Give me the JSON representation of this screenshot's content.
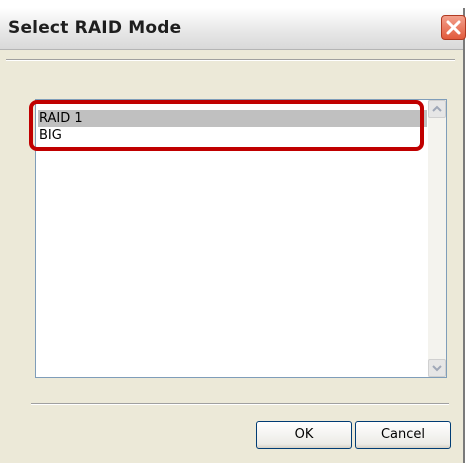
{
  "dialog": {
    "title": "Select RAID Mode",
    "close_icon": "close-icon"
  },
  "list": {
    "items": [
      {
        "label": "RAID 1",
        "selected": true
      },
      {
        "label": "BIG",
        "selected": false
      }
    ]
  },
  "buttons": {
    "ok_label": "OK",
    "cancel_label": "Cancel"
  },
  "colors": {
    "highlight": "#c00000",
    "selection": "#c0c0c0",
    "close_button": "#e25a3c"
  }
}
